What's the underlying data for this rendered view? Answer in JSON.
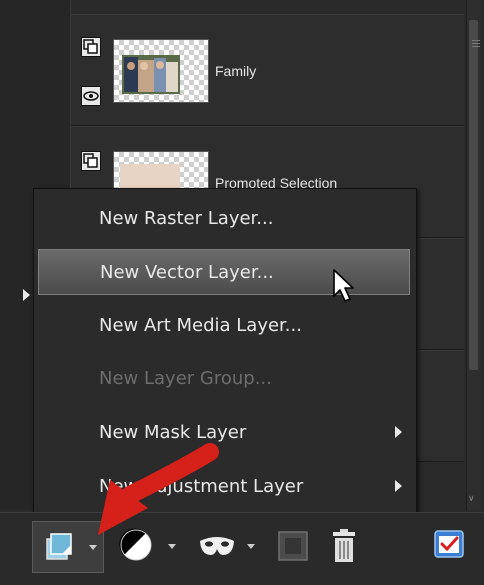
{
  "layers": [
    {
      "name": "Family"
    },
    {
      "name": "Promoted Selection"
    }
  ],
  "menu": {
    "items": [
      {
        "label": "New Raster Layer...",
        "state": "normal",
        "submenu": false
      },
      {
        "label": "New Vector Layer...",
        "state": "highlighted",
        "submenu": false
      },
      {
        "label": "New Art Media Layer...",
        "state": "normal",
        "submenu": false
      },
      {
        "label": "New Layer Group...",
        "state": "disabled",
        "submenu": false
      },
      {
        "label": "New Mask Layer",
        "state": "normal",
        "submenu": true
      },
      {
        "label": "New Adjustment Layer",
        "state": "normal",
        "submenu": true
      }
    ]
  },
  "toolbar": {
    "icons": [
      "new-layer-icon",
      "contrast-icon",
      "mask-icon",
      "layer-frame-icon",
      "trash-icon",
      "checklist-icon"
    ]
  },
  "colors": {
    "accent_red": "#d6201a",
    "menu_highlight": "#5e5e5e",
    "new_layer_blue": "#5aa9c9"
  }
}
